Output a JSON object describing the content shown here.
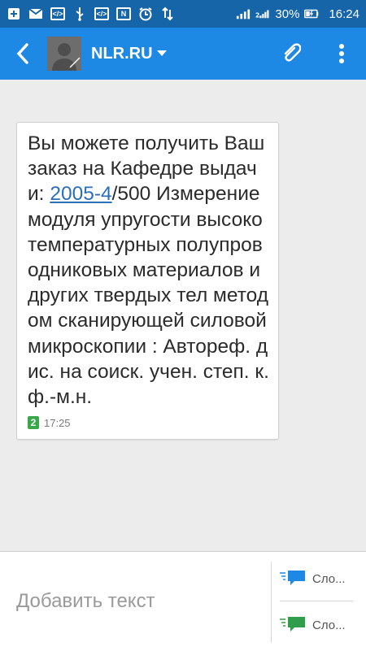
{
  "status_bar": {
    "battery_percent": "30%",
    "time": "16:24"
  },
  "toolbar": {
    "contact_name": "NLR.RU"
  },
  "message": {
    "text_before_link": "Вы можете получить Ваш заказ на Кафедре выдачи: ",
    "link_text": "2005-4",
    "text_after_link": "/500 Измерение модуля упругости высокотемпературных полупроводниковых материалов и других твердых тел методом сканирующей силовой микроскопии : Автореф. дис. на соиск. учен. степ. к.ф.-м.н.",
    "sim_slot": "2",
    "time": "17:25"
  },
  "composer": {
    "placeholder": "Добавить текст",
    "send_sim1_label": "Сло...",
    "send_sim2_label": "Сло..."
  },
  "colors": {
    "status_bar": "#1565a8",
    "toolbar": "#1e88e5",
    "link": "#2b6fb8",
    "sim1_send": "#1e88e5",
    "sim2_send": "#2e9e4a"
  }
}
